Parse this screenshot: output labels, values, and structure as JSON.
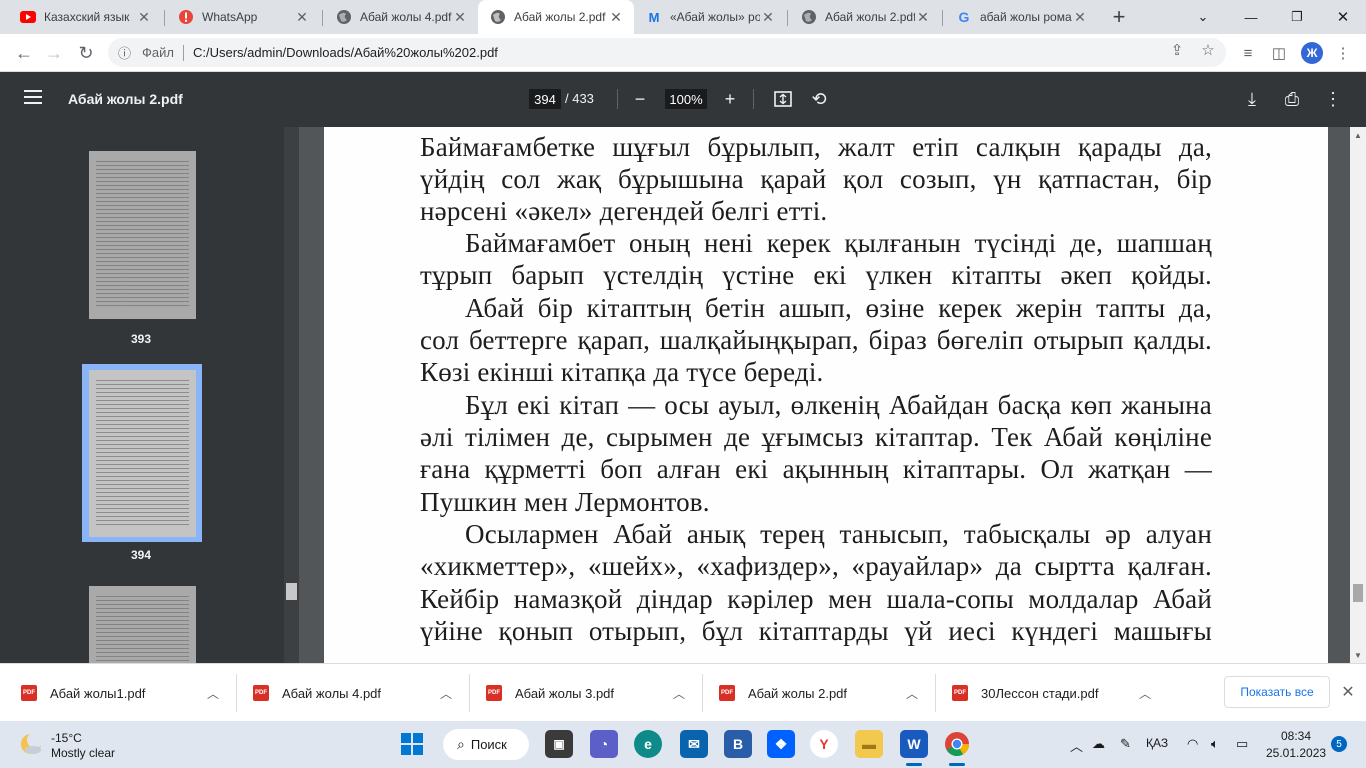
{
  "tabs": [
    {
      "title": "Казахский язык",
      "icon": "youtube-icon",
      "color": "#ff0000"
    },
    {
      "title": "WhatsApp",
      "icon": "whatsapp-alert-icon",
      "color": "#e8453c"
    },
    {
      "title": "Абай жолы 4.pdf",
      "icon": "globe-icon",
      "color": "#5f6368"
    },
    {
      "title": "Абай жолы 2.pdf",
      "icon": "globe-icon",
      "color": "#5f6368",
      "active": true
    },
    {
      "title": "«Абай жолы» ро",
      "icon": "mail-icon",
      "color": "#1a73e8"
    },
    {
      "title": "Абай жолы 2.pdf",
      "icon": "globe-icon",
      "color": "#5f6368"
    },
    {
      "title": "абай жолы рома",
      "icon": "google-icon",
      "color": "#4285f4"
    }
  ],
  "address": {
    "scheme": "Файл",
    "url": "C:/Users/admin/Downloads/Абай%20жолы%202.pdf"
  },
  "profile": {
    "initial": "Ж"
  },
  "pdf": {
    "title": "Абай жолы 2.pdf",
    "current_page": "394",
    "total_pages": "/ 433",
    "zoom": "100%"
  },
  "thumbnails": [
    {
      "label": "393"
    },
    {
      "label": "394",
      "selected": true
    }
  ],
  "page_lines": [
    "Баймағамбетке шұғыл бұрылып, жалт етіп салқын қарады да,",
    "үйдің сол жақ бұрышына қарай қол созып, үн қатпастан, бір",
    "нәрсені «әкел» дегендей белгі етті.",
    "Баймағамбет оның нені керек қылғанын түсінді де, шапшаң",
    "тұрып барып үстелдің үстіне екі үлкен кітапты әкеп қойды.",
    "Абай бір кітаптың бетін ашып, өзіне керек жерін тапты да,",
    "сол беттерге қарап, шалқайыңқырап, біраз бөгеліп отырып қалды.",
    "Көзі екінші кітапқа да түсе береді.",
    "Бұл екі кітап — осы ауыл, өлкенің Абайдан басқа көп жанына",
    "әлі тілімен де, сырымен де ұғымсыз кітаптар. Тек Абай көңіліне",
    "ғана құрметті боп алған екі ақынның кітаптары. Ол жатқан —",
    "Пушкин мен Лермонтов.",
    "Осылармен Абай анық терең танысып, табысқалы әр алуан",
    "«хикметтер», «шейх», «хафиздер», «рауайлар» да сыртта қалған.",
    "Кейбір намазқой діндар кәрілер мен шала-сопы молдалар Абай",
    "үйіне қонып отырып, бұл кітаптарды үй иесі күндегі машығы"
  ],
  "downloads": [
    {
      "name": "Абай жолы1.pdf"
    },
    {
      "name": "Абай жолы 4.pdf"
    },
    {
      "name": "Абай жолы 3.pdf"
    },
    {
      "name": "Абай жолы 2.pdf"
    },
    {
      "name": "30Лессон стади.pdf"
    }
  ],
  "downloads_show_all": "Показать все",
  "taskbar": {
    "weather_temp": "-15°C",
    "weather_desc": "Mostly clear",
    "search_label": "Поиск",
    "language": "ҚАЗ",
    "time": "08:34",
    "date": "25.01.2023",
    "notifications": "5"
  },
  "colors": {
    "pdf_toolbar": "#323639",
    "viewer_bg": "#525659",
    "accent": "#8ab4f8",
    "taskbar": "#dfe6ef"
  }
}
